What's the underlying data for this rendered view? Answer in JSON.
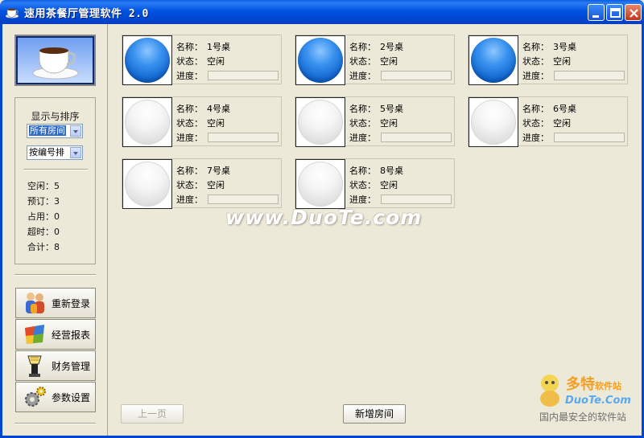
{
  "window": {
    "title": "速用茶餐厅管理软件 2.0"
  },
  "sidebar": {
    "display_title": "显示与排序",
    "filter_select": "所有房间",
    "sort_select": "按编号排",
    "stats": [
      {
        "label": "空闲",
        "value": "5"
      },
      {
        "label": "预订",
        "value": "3"
      },
      {
        "label": "占用",
        "value": "0"
      },
      {
        "label": "超时",
        "value": "0"
      },
      {
        "label": "合计",
        "value": "8"
      }
    ],
    "nav": [
      {
        "label": "重新登录",
        "icon": "users-icon"
      },
      {
        "label": "经营报表",
        "icon": "chart-icon"
      },
      {
        "label": "财务管理",
        "icon": "lamp-icon"
      },
      {
        "label": "参数设置",
        "icon": "gears-icon"
      }
    ]
  },
  "field_labels": {
    "name": "名称：",
    "status": "状态：",
    "progress": "进度："
  },
  "tables": [
    {
      "name": "1号桌",
      "status": "空闲",
      "state": "occupied",
      "progress": 0
    },
    {
      "name": "2号桌",
      "status": "空闲",
      "state": "occupied",
      "progress": 0
    },
    {
      "name": "3号桌",
      "status": "空闲",
      "state": "occupied",
      "progress": 0
    },
    {
      "name": "4号桌",
      "status": "空闲",
      "state": "free",
      "progress": 0
    },
    {
      "name": "5号桌",
      "status": "空闲",
      "state": "free",
      "progress": 0
    },
    {
      "name": "6号桌",
      "status": "空闲",
      "state": "free",
      "progress": 0
    },
    {
      "name": "7号桌",
      "status": "空闲",
      "state": "free",
      "progress": 0
    },
    {
      "name": "8号桌",
      "status": "空闲",
      "state": "free",
      "progress": 0
    }
  ],
  "footer": {
    "prev_label": "上一页",
    "add_room_label": "新增房间"
  },
  "watermark": "www.DuoTe.com",
  "corner_logo": {
    "brand": "多特",
    "brand_suffix": "软件站",
    "site": "DuoTe.Com",
    "slogan": "国内最安全的软件站"
  },
  "colors": {
    "titlebar": "#0053e1",
    "occupied_ball": "#3a93ef",
    "free_ball": "#f0f0f0",
    "background": "#ece9d8"
  }
}
